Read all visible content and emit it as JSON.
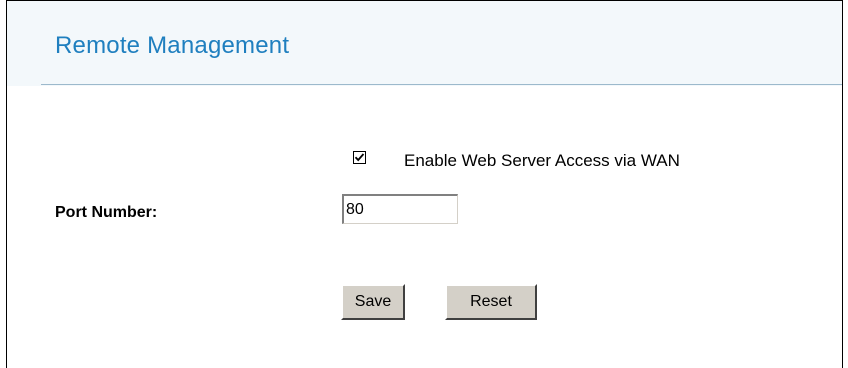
{
  "page": {
    "title": "Remote Management"
  },
  "web_access": {
    "label": "Enable Web Server Access via WAN",
    "checked": true
  },
  "port": {
    "label": "Port Number:",
    "value": "80"
  },
  "actions": {
    "save_label": "Save",
    "reset_label": "Reset"
  },
  "colors": {
    "title": "#1f7fbf",
    "header_band": "#f3f8fb",
    "button_face": "#d4d0c8"
  }
}
